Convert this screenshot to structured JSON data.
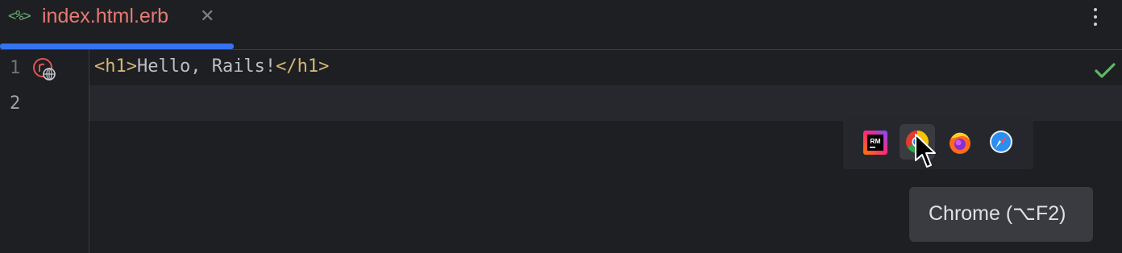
{
  "editor_tab": {
    "icon": "<%>",
    "title": "index.html.erb",
    "close": "✕",
    "accent_color": "#3574f0",
    "title_color": "#e57a73"
  },
  "gutter": {
    "lines": [
      "1",
      "2"
    ]
  },
  "code": {
    "line1": {
      "open_tag": "<h1>",
      "text": "Hello, Rails!",
      "close_tag": "</h1>"
    }
  },
  "inspection_status": "check-icon",
  "browser_popup": {
    "browsers": [
      {
        "name": "RubyMine",
        "icon": "rubymine-icon",
        "label": "RM"
      },
      {
        "name": "Chrome",
        "icon": "chrome-icon"
      },
      {
        "name": "Firefox",
        "icon": "firefox-icon"
      },
      {
        "name": "Safari",
        "icon": "safari-icon"
      }
    ]
  },
  "tooltip": {
    "text": "Chrome (⌥F2)"
  }
}
